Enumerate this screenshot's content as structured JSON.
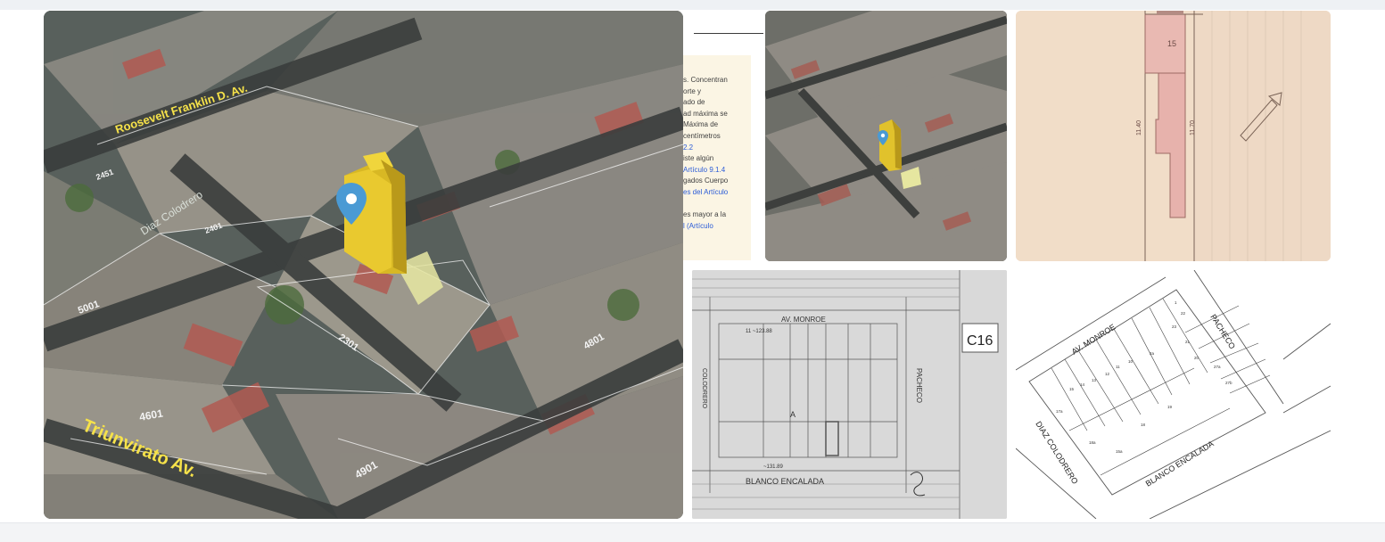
{
  "main_view": {
    "street_top": "Roosevelt Franklin D. Av.",
    "street_diag": "Diaz Colodrero",
    "street_bottom": "Triunvirato Av.",
    "numbers": [
      "2451",
      "2401",
      "5001",
      "2301",
      "4801",
      "4601",
      "4901"
    ]
  },
  "doc_snippet": {
    "lines": [
      {
        "text": "s. Concentran",
        "link": false
      },
      {
        "text": "orte y",
        "link": false
      },
      {
        "text": "ado de",
        "link": false
      },
      {
        "text": "ad máxima se",
        "link": false
      },
      {
        "text": "Máxima de",
        "link": false
      },
      {
        "text": "centímetros",
        "link": false
      },
      {
        "text": "2.2",
        "link": true
      },
      {
        "text": "iste algún",
        "link": false
      },
      {
        "text": "Artículo 9.1.4",
        "link": true
      },
      {
        "text": "gados Cuerpo",
        "link": false
      },
      {
        "text": "es del Artículo",
        "link": true
      },
      {
        "text": "",
        "link": false
      },
      {
        "text": "es mayor a la",
        "link": false
      },
      {
        "text": "l (Artículo",
        "link": true
      }
    ]
  },
  "blueprint": {
    "street_top": "AV. MONROE",
    "street_bottom": "BLANCO ENCALADA",
    "street_right": "PACHECO",
    "street_left": "COLODRERO",
    "code": "C16",
    "letter": "A",
    "dims_top": "11 ~123.88",
    "dims_bottom": "~131.89"
  },
  "lot_plan": {
    "street_top": "AV. MONROE",
    "street_right": "PACHECO",
    "street_left": "DIAZ COLODRERO",
    "street_bottom": "BLANCO ENCALADA",
    "lots": [
      "1",
      "22",
      "23",
      "2a",
      "21",
      "20",
      "19",
      "18",
      "17a",
      "15",
      "14",
      "13",
      "12",
      "11",
      "10",
      "9",
      "8",
      "7",
      "6",
      "5",
      "4",
      "3",
      "2",
      "27a",
      "27b",
      "18a",
      "15a",
      "26",
      "25",
      "24"
    ]
  },
  "plan_pink": {
    "label_top": "15",
    "dim_left": "11.40",
    "dim_right": "11.70"
  }
}
